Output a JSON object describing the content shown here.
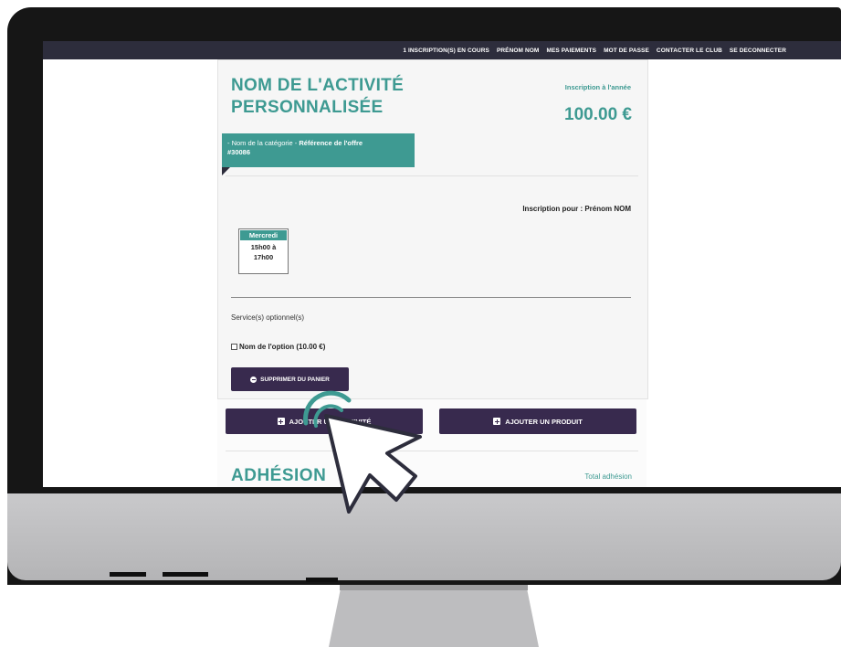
{
  "nav": {
    "items": [
      "1 INSCRIPTION(S) EN COURS",
      "PRÉNOM NOM",
      "MES PAIEMENTS",
      "MOT DE PASSE",
      "CONTACTER LE CLUB",
      "SE DECONNECTER"
    ]
  },
  "activity": {
    "title_line1": "NOM DE L'ACTIVITÉ",
    "title_line2": "PERSONNALISÉE",
    "plan": "Inscription à l'année",
    "price": "100.00 €",
    "category": "- Nom de la catégorie - ",
    "offer_ref": "Référence de l'offre",
    "offer_id": "#30086",
    "registration_for": "Inscription pour : Prénom NOM",
    "schedule": {
      "day": "Mercredi",
      "time_line1": "15h00 à",
      "time_line2": "17h00"
    },
    "optional_services_label": "Service(s) optionnel(s)",
    "option_label": "Nom de l'option (10.00 €)",
    "remove_button": "SUPPRIMER DU PANIER"
  },
  "actions": {
    "add_activity": "AJOUTER UNE ACTIVITÉ",
    "add_product": "AJOUTER UN PRODUIT"
  },
  "membership": {
    "title": "ADHÉSION",
    "total_label": "Total adhésion"
  },
  "colors": {
    "teal": "#3e9a92",
    "purple": "#382a4e",
    "navbar": "#2d2d3c"
  },
  "icons": {
    "remove": "minus-circle-icon",
    "add": "plus-square-icon",
    "cursor": "pointer-cursor-icon"
  }
}
